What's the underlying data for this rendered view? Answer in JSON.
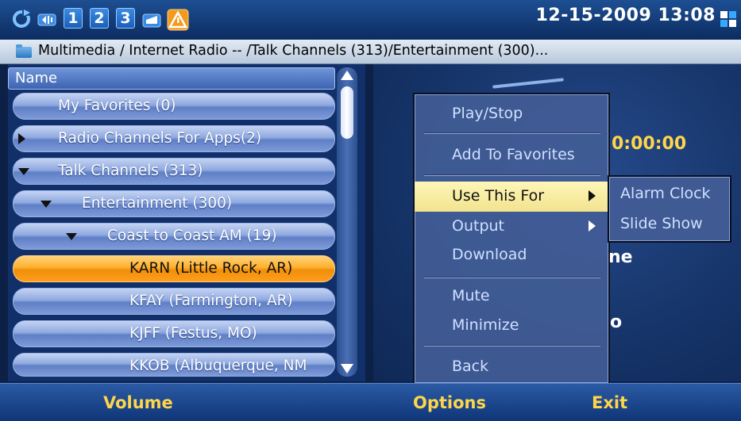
{
  "status_bar": {
    "icons": [
      "refresh-icon",
      "volume-icon",
      "bluetooth-icon",
      "headset-icon",
      "warning-icon",
      "grid-icon"
    ],
    "line_numbers": [
      "1",
      "2",
      "3"
    ],
    "datetime": "12-15-2009 13:08"
  },
  "breadcrumb": {
    "text": "Multimedia / Internet Radio  --  /Talk Channels (313)/Entertainment (300)..."
  },
  "list": {
    "header": "Name",
    "items": [
      {
        "label": "My Favorites (0)",
        "expander": "none",
        "selected": false
      },
      {
        "label": "Radio Channels For Apps(2)",
        "expander": "collapsed",
        "selected": false
      },
      {
        "label": "Talk Channels (313)",
        "expander": "expanded",
        "selected": false
      },
      {
        "label": "Entertainment (300)",
        "expander": "expanded",
        "selected": false
      },
      {
        "label": "Coast to Coast AM (19)",
        "expander": "expanded",
        "selected": false
      },
      {
        "label": "KARN (Little Rock, AR)",
        "expander": "none",
        "selected": true
      },
      {
        "label": "KFAY (Farmington, AR)",
        "expander": "none",
        "selected": false
      },
      {
        "label": "KJFF (Festus, MO)",
        "expander": "none",
        "selected": false
      },
      {
        "label": "KKOB (Albuquerque, NM",
        "expander": "none",
        "selected": false
      }
    ]
  },
  "player": {
    "time": "0:00:00",
    "fragment_1": "ne",
    "fragment_2": "o"
  },
  "options_menu": {
    "items": [
      {
        "label": "Play/Stop",
        "submenu": false,
        "active": false
      },
      {
        "label": "Add To Favorites",
        "submenu": false,
        "active": false
      },
      {
        "label": "Use This For",
        "submenu": true,
        "active": true
      },
      {
        "label": "Output",
        "submenu": true,
        "active": false
      },
      {
        "label": "Download",
        "submenu": false,
        "active": false
      },
      {
        "label": "Mute",
        "submenu": false,
        "active": false
      },
      {
        "label": "Minimize",
        "submenu": false,
        "active": false
      },
      {
        "label": "Back",
        "submenu": false,
        "active": false
      }
    ]
  },
  "submenu": {
    "items": [
      "Alarm Clock",
      "Slide Show"
    ]
  },
  "softkeys": {
    "left": "Volume",
    "center": "Options",
    "right": "Exit"
  },
  "colors": {
    "selected_row": "#f08f0a",
    "accent_text": "#ffd54a",
    "menu_highlight": "#f1e38e"
  }
}
